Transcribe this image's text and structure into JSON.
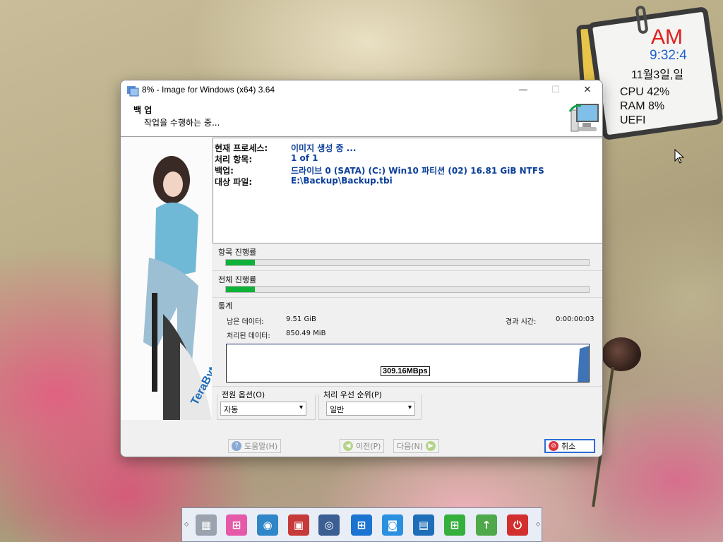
{
  "gadget": {
    "ampm": "AM",
    "time": "9:32:4",
    "date": "11월3일,일",
    "cpu": "CPU  42%",
    "ram": "RAM  8%",
    "boot": "UEFI"
  },
  "window": {
    "title": "8% - Image for Windows (x64) 3.64",
    "header_title": "백 업",
    "header_subtitle": "작업을 수행하는 중...",
    "controls": {
      "minimize": "—",
      "maximize": "☐",
      "close": "✕"
    }
  },
  "info": [
    {
      "label": "현재 프로세스:",
      "value": "이미지 생성 중 ..."
    },
    {
      "label": "처리 항목:",
      "value": "1 of 1"
    },
    {
      "label": "백업:",
      "value": "드라이브 0 (SATA) (C:) Win10 파티션 (02) 16.81 GiB NTFS"
    },
    {
      "label": "대상 파일:",
      "value": "E:\\Backup\\Backup.tbi"
    }
  ],
  "progress": {
    "item_label": "항목 진행률",
    "item_percent": 8,
    "total_label": "전체 진행률",
    "total_percent": 8
  },
  "stats": {
    "group_label": "통계",
    "remaining_label": "남은 데이터:",
    "remaining_value": "9.51 GiB",
    "processed_label": "처리된 데이터:",
    "processed_value": "850.49 MiB",
    "elapsed_label": "경과 시간:",
    "elapsed_value": "0:00:00:03",
    "speed": "309.16MBps"
  },
  "options": {
    "power_label": "전원 옵션(O)",
    "power_value": "자동",
    "priority_label": "처리 우선 순위(P)",
    "priority_value": "일반"
  },
  "buttons": {
    "help": "도움말(H)",
    "prev": "이전(P)",
    "next": "다음(N)",
    "cancel": "취소"
  },
  "colors": {
    "progress_fill": "#0fb238",
    "info_value": "#0b3f9a",
    "gadget_ampm": "#e02020",
    "gadget_time": "#1f5fd0"
  }
}
